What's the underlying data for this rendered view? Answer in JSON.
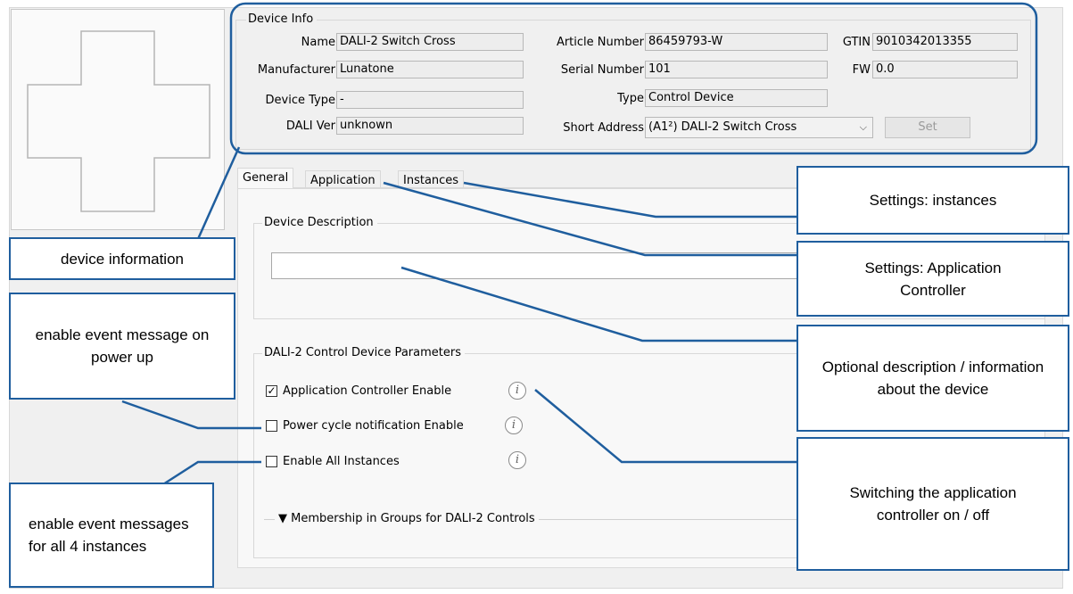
{
  "device_info": {
    "title": "Device Info",
    "name_label": "Name",
    "name_value": "DALI-2 Switch Cross",
    "manufacturer_label": "Manufacturer",
    "manufacturer_value": "Lunatone",
    "device_type_label": "Device Type",
    "device_type_value": "-",
    "dali_ver_label": "DALI Ver",
    "dali_ver_value": "unknown",
    "article_number_label": "Article Number",
    "article_number_value": "86459793-W",
    "serial_number_label": "Serial Number",
    "serial_number_value": "101",
    "type_label": "Type",
    "type_value": "Control Device",
    "short_address_label": "Short Address",
    "short_address_value": "(A1²) DALI-2 Switch Cross",
    "gtin_label": "GTIN",
    "gtin_value": "9010342013355",
    "fw_label": "FW",
    "fw_value": "0.0",
    "set_button": "Set"
  },
  "tabs": [
    {
      "label": "General"
    },
    {
      "label": "Application"
    },
    {
      "label": "Instances"
    }
  ],
  "device_description": {
    "title": "Device Description",
    "value": ""
  },
  "control_params": {
    "title": "DALI-2 Control Device Parameters",
    "app_controller_label": "Application Controller Enable",
    "app_controller_checked": true,
    "power_cycle_label": "Power cycle notification Enable",
    "power_cycle_checked": false,
    "enable_instances_label": "Enable All Instances",
    "enable_instances_checked": false,
    "check_mark": "☑",
    "info_glyph": "i"
  },
  "membership": {
    "label": "▼ Membership in Groups for DALI-2 Controls"
  },
  "callouts": {
    "device_information": "device information",
    "power_up": "enable event message on power up",
    "all_instances": "enable event messages for all 4 instances",
    "settings_instances": "Settings: instances",
    "settings_application": "Settings: Application Controller",
    "description_info": "Optional description / information about the device",
    "switching": "Switching the application controller on / off"
  },
  "colors": {
    "annotation_blue": "#1f5e9e"
  }
}
